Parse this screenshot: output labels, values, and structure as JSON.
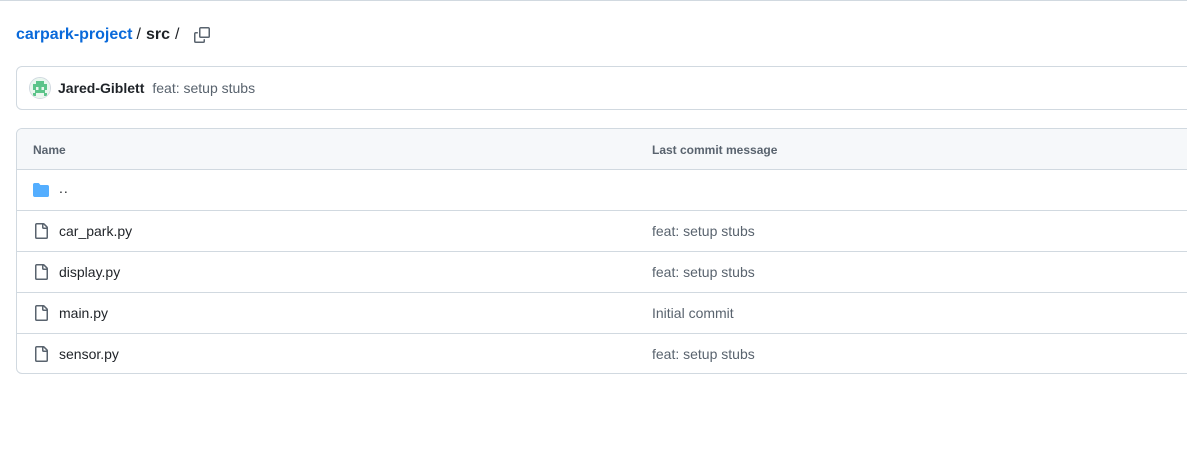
{
  "breadcrumb": {
    "repo": "carpark-project",
    "sep1": "/",
    "folder": "src",
    "sep2": "/"
  },
  "latest_commit": {
    "author": "Jared-Giblett",
    "message": "feat: setup stubs"
  },
  "table": {
    "headers": {
      "name": "Name",
      "last_commit_message": "Last commit message"
    },
    "parent": "..",
    "rows": [
      {
        "name": "car_park.py",
        "message": "feat: setup stubs"
      },
      {
        "name": "display.py",
        "message": "feat: setup stubs"
      },
      {
        "name": "main.py",
        "message": "Initial commit"
      },
      {
        "name": "sensor.py",
        "message": "feat: setup stubs"
      }
    ]
  },
  "icons": {
    "copy": "copy-icon",
    "folder": "folder-icon",
    "file": "file-icon"
  },
  "colors": {
    "link": "#0969da",
    "folder": "#54aeff",
    "muted_text": "#59636e",
    "border": "#d1d9e0",
    "header_bg": "#f6f8fa"
  }
}
